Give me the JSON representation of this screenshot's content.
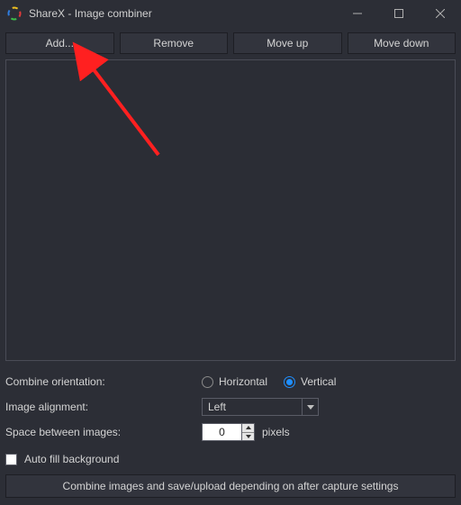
{
  "titlebar": {
    "title": "ShareX - Image combiner"
  },
  "toolbar": {
    "add": "Add...",
    "remove": "Remove",
    "moveup": "Move up",
    "movedown": "Move down"
  },
  "form": {
    "orientation_label": "Combine orientation:",
    "orientation_horizontal": "Horizontal",
    "orientation_vertical": "Vertical",
    "orientation_value": "Vertical",
    "alignment_label": "Image alignment:",
    "alignment_value": "Left",
    "space_label": "Space between images:",
    "space_value": "0",
    "space_unit": "pixels",
    "autofill_label": "Auto fill background",
    "autofill_checked": false
  },
  "actions": {
    "combine": "Combine images and save/upload depending on after capture settings"
  }
}
